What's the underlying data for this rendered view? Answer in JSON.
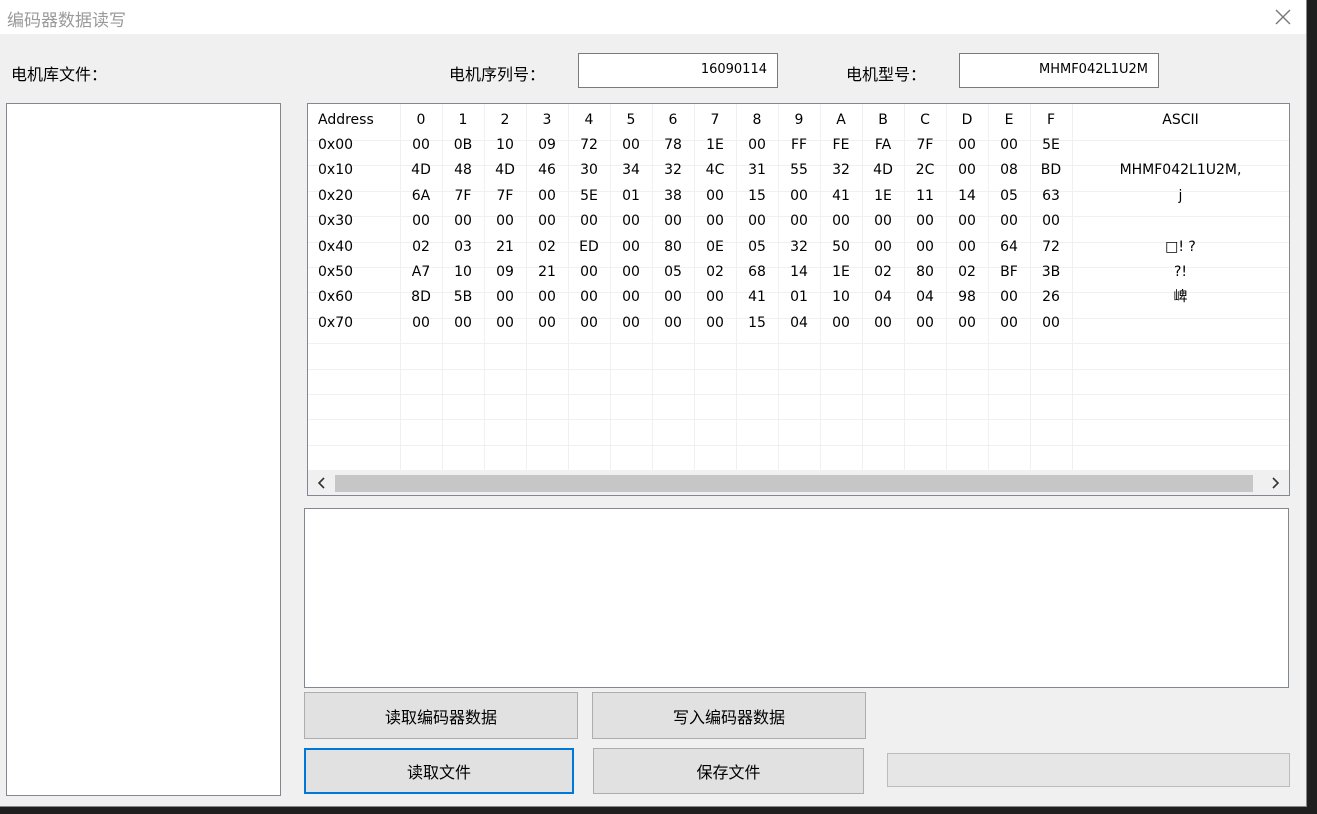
{
  "window": {
    "title": "编码器数据读写"
  },
  "motor": {
    "library_label": "电机库文件：",
    "serial_label": "电机序列号：",
    "serial_value": "16090114",
    "model_label": "电机型号：",
    "model_value": "MHMF042L1U2M"
  },
  "hex_table": {
    "headers": [
      "Address",
      "0",
      "1",
      "2",
      "3",
      "4",
      "5",
      "6",
      "7",
      "8",
      "9",
      "A",
      "B",
      "C",
      "D",
      "E",
      "F",
      "ASCII"
    ],
    "rows": [
      {
        "addr": "0x00",
        "bytes": [
          "00",
          "0B",
          "10",
          "09",
          "72",
          "00",
          "78",
          "1E",
          "00",
          "FF",
          "FE",
          "FA",
          "7F",
          "00",
          "00",
          "5E"
        ],
        "ascii": ""
      },
      {
        "addr": "0x10",
        "bytes": [
          "4D",
          "48",
          "4D",
          "46",
          "30",
          "34",
          "32",
          "4C",
          "31",
          "55",
          "32",
          "4D",
          "2C",
          "00",
          "08",
          "BD"
        ],
        "ascii": "MHMF042L1U2M,"
      },
      {
        "addr": "0x20",
        "bytes": [
          "6A",
          "7F",
          "7F",
          "00",
          "5E",
          "01",
          "38",
          "00",
          "15",
          "00",
          "41",
          "1E",
          "11",
          "14",
          "05",
          "63"
        ],
        "ascii": "j"
      },
      {
        "addr": "0x30",
        "bytes": [
          "00",
          "00",
          "00",
          "00",
          "00",
          "00",
          "00",
          "00",
          "00",
          "00",
          "00",
          "00",
          "00",
          "00",
          "00",
          "00"
        ],
        "ascii": ""
      },
      {
        "addr": "0x40",
        "bytes": [
          "02",
          "03",
          "21",
          "02",
          "ED",
          "00",
          "80",
          "0E",
          "05",
          "32",
          "50",
          "00",
          "00",
          "00",
          "64",
          "72"
        ],
        "ascii": "□! ?"
      },
      {
        "addr": "0x50",
        "bytes": [
          "A7",
          "10",
          "09",
          "21",
          "00",
          "00",
          "05",
          "02",
          "68",
          "14",
          "1E",
          "02",
          "80",
          "02",
          "BF",
          "3B"
        ],
        "ascii": "?!"
      },
      {
        "addr": "0x60",
        "bytes": [
          "8D",
          "5B",
          "00",
          "00",
          "00",
          "00",
          "00",
          "00",
          "41",
          "01",
          "10",
          "04",
          "04",
          "98",
          "00",
          "26"
        ],
        "ascii": "崥"
      },
      {
        "addr": "0x70",
        "bytes": [
          "00",
          "00",
          "00",
          "00",
          "00",
          "00",
          "00",
          "00",
          "15",
          "04",
          "00",
          "00",
          "00",
          "00",
          "00",
          "00"
        ],
        "ascii": ""
      }
    ]
  },
  "buttons": {
    "read_encoder": "读取编码器数据",
    "write_encoder": "写入编码器数据",
    "read_file": "读取文件",
    "save_file": "保存文件"
  },
  "icons": {
    "close": "close-icon",
    "scroll_left": "chevron-left-icon",
    "scroll_right": "chevron-right-icon"
  },
  "colors": {
    "focus_border": "#0078d7",
    "window_bg": "#f0f0f0",
    "title_text": "#9a9a9a"
  }
}
